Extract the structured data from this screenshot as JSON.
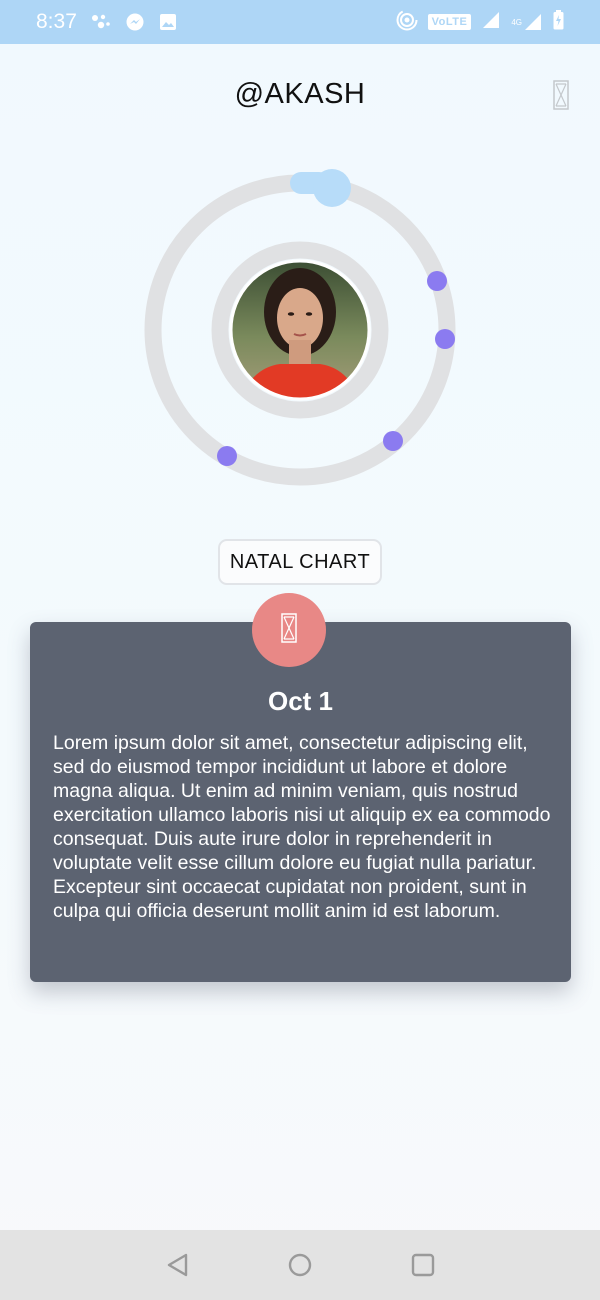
{
  "status_bar": {
    "time": "8:37",
    "network_label": "VoLTE",
    "network_type": "4G",
    "icons": [
      "assistant-icon",
      "messenger-icon",
      "gallery-icon",
      "hotspot-icon",
      "signal-icon",
      "battery-icon"
    ]
  },
  "header": {
    "title": "@AKASH",
    "action_icon": "image-placeholder-icon"
  },
  "chart": {
    "orbit_color": "#e0e1e3",
    "planet_color": "#8b7bf0",
    "sun_color": "#b7dcf9",
    "center_avatar": "profile-photo"
  },
  "natal_button": {
    "label": "NATAL CHART"
  },
  "card": {
    "badge_icon": "image-placeholder-icon",
    "badge_color": "#e88886",
    "title": "Oct 1",
    "body": "Lorem ipsum dolor sit amet, consectetur adipiscing elit, sed do eiusmod tempor incididunt ut labore et dolore magna aliqua. Ut enim ad minim veniam, quis nostrud exercitation ullamco laboris nisi ut aliquip ex ea commodo consequat. Duis aute irure dolor in reprehenderit in voluptate velit esse cillum dolore eu fugiat nulla pariatur. Excepteur sint occaecat cupidatat non proident, sunt in culpa qui officia deserunt mollit anim id est laborum.",
    "background": "#5c6371"
  },
  "nav_bar": {
    "buttons": [
      "back-icon",
      "home-icon",
      "recents-icon"
    ]
  }
}
